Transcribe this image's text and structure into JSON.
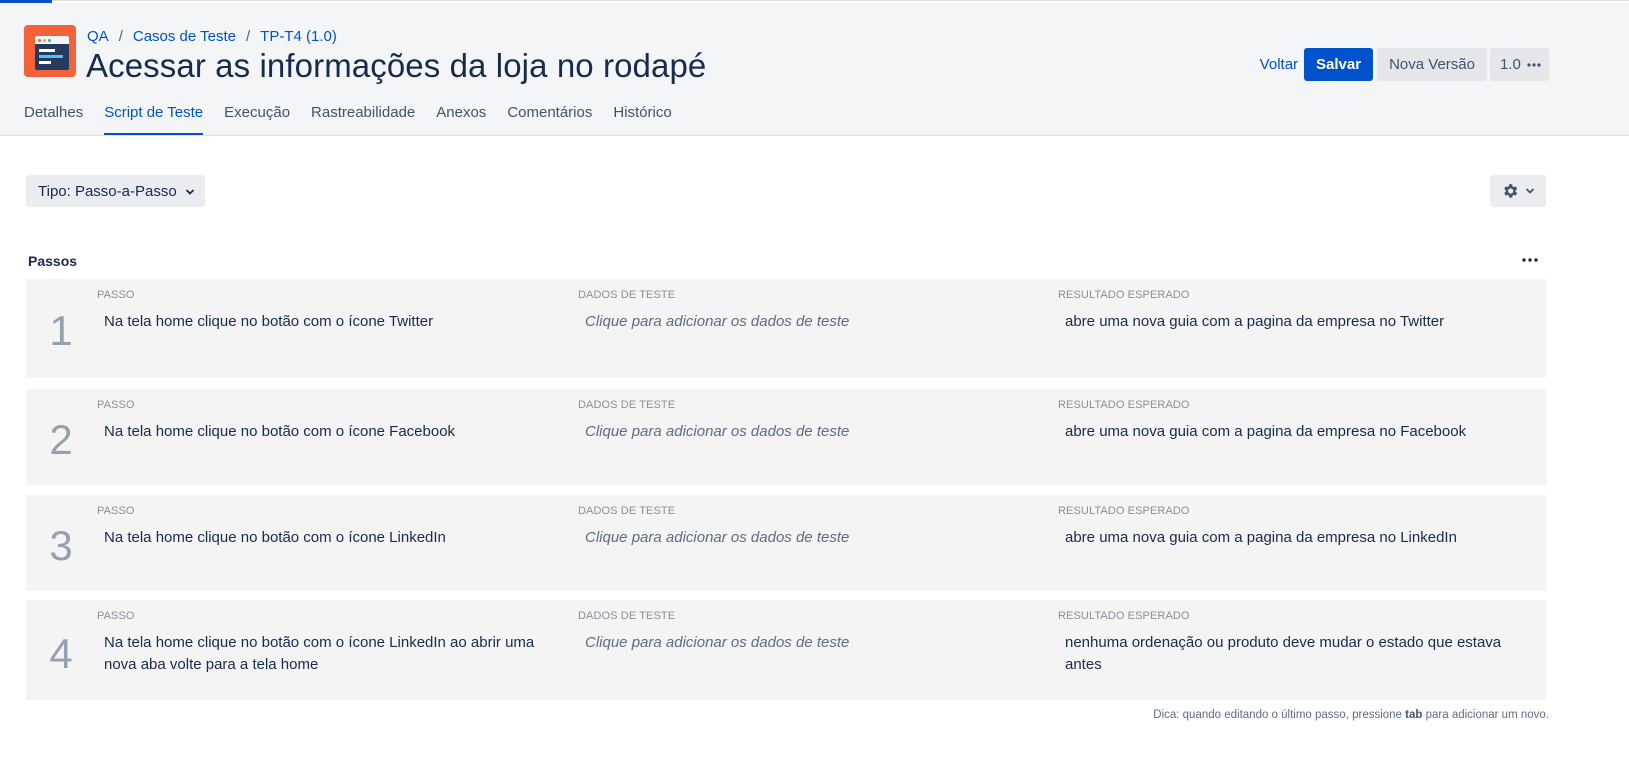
{
  "breadcrumb": {
    "project": "QA",
    "section": "Casos de Teste",
    "item": "TP-T4 (1.0)"
  },
  "page": {
    "title": "Acessar as informações da loja no rodapé"
  },
  "actions": {
    "back": "Voltar",
    "save": "Salvar",
    "new_version": "Nova Versão",
    "version": "1.0"
  },
  "tabs": [
    "Detalhes",
    "Script de Teste",
    "Execução",
    "Rastreabilidade",
    "Anexos",
    "Comentários",
    "Histórico"
  ],
  "active_tab": "Script de Teste",
  "script": {
    "type_select": "Tipo: Passo-a-Passo"
  },
  "steps_section": {
    "title": "Passos",
    "column_labels": {
      "step": "PASSO",
      "data": "DADOS DE TESTE",
      "expected": "RESULTADO ESPERADO"
    },
    "steps": [
      {
        "number": "1",
        "step": "Na tela home clique no botão com o ícone Twitter",
        "data": "Clique para adicionar os dados de teste",
        "expected": "abre uma nova guia com a pagina da empresa no Twitter"
      },
      {
        "number": "2",
        "step": "Na tela home clique no botão com o ícone Facebook",
        "data": "Clique para adicionar os dados de teste",
        "expected": "abre uma nova guia com a pagina da empresa no Facebook"
      },
      {
        "number": "3",
        "step": "Na tela home clique no botão com o ícone LinkedIn",
        "data": "Clique para adicionar os dados de teste",
        "expected": "abre uma nova guia com a pagina da empresa no LinkedIn"
      },
      {
        "number": "4",
        "step": "Na tela home clique no botão com o ícone LinkedIn ao abrir uma nova aba volte para a tela home",
        "data": "Clique para adicionar os dados de teste",
        "expected": "nenhuma ordenação ou produto deve mudar o estado que estava antes"
      }
    ]
  },
  "hint": {
    "before": "Dica: quando editando o último passo, pressione",
    "key": "tab",
    "after": "para adicionar um novo."
  },
  "icons": {
    "logo": "test-case-app-logo",
    "gear": "gear-icon",
    "chevron": "chevron-down-icon",
    "more": "more-horizontal-icon"
  },
  "colors": {
    "accent": "#0052cc",
    "logo": "#f4623a",
    "header_bg": "#f4f5f7",
    "step_bg": "#f4f4f4"
  }
}
